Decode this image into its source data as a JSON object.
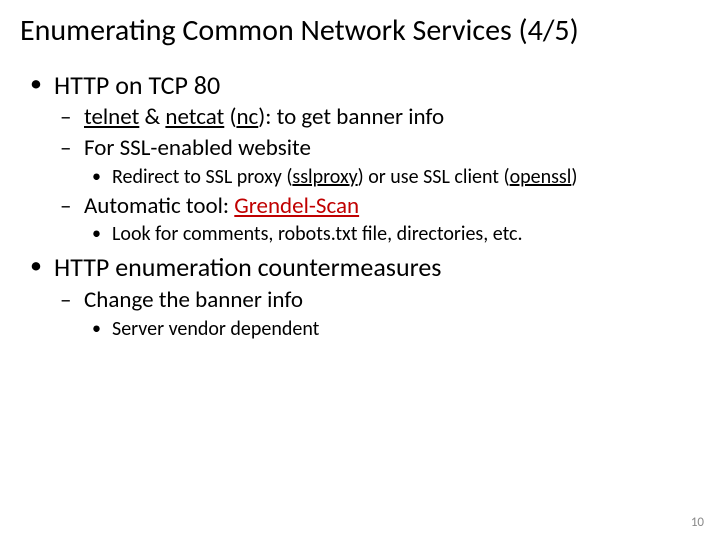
{
  "title": "Enumerating Common Network Services (4/5)",
  "page_number": "10",
  "b1": {
    "heading": "HTTP on TCP 80",
    "s1": {
      "telnet": "telnet",
      "amp": " & ",
      "netcat": "netcat",
      "nc_open": " (",
      "nc": "nc",
      "nc_close": "): to get banner info"
    },
    "s2": "For SSL-enabled website",
    "s2a": {
      "pre": "Redirect to SSL proxy (",
      "sslproxy": "sslproxy",
      "mid": ") or use SSL client (",
      "openssl": "openssl",
      "post": ")"
    },
    "s3": {
      "pre": "Automatic tool: ",
      "tool": "Grendel-Scan"
    },
    "s3a": "Look for comments, robots.txt file, directories, etc."
  },
  "b2": {
    "heading": "HTTP enumeration countermeasures",
    "s1": "Change the banner info",
    "s1a": "Server vendor dependent"
  }
}
